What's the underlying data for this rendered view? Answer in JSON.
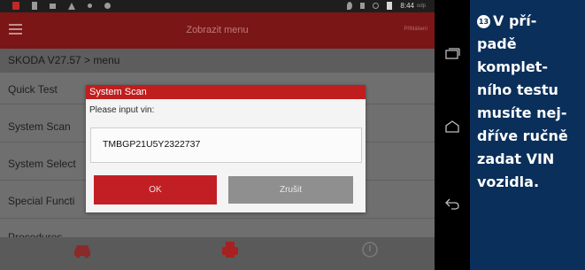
{
  "statusbar": {
    "time": "8:44",
    "ampm": "odp"
  },
  "appbar": {
    "title": "Zobrazit menu",
    "right_label": "Přihlášení"
  },
  "breadcrumb": "SKODA V27.57 > menu",
  "menu_items": [
    {
      "label": "Quick Test"
    },
    {
      "label": "System Scan"
    },
    {
      "label": "System Select"
    },
    {
      "label": "Special Functi"
    },
    {
      "label": "Procedures"
    }
  ],
  "dialog": {
    "title": "System Scan",
    "prompt": "Please input vin:",
    "vin_value": "TMBGP21U5Y2322737",
    "ok_label": "OK",
    "cancel_label": "Zrušit"
  },
  "caption": {
    "number": "13",
    "lines": [
      "V pří-",
      "padě",
      "komplet-",
      "ního testu",
      "musíte nej-",
      "dříve ručně",
      "zadat VIN",
      "vozidla."
    ]
  },
  "colors": {
    "appbar": "#7a1616",
    "dialog_title": "#bf1e1e",
    "ok_button": "#c21f24",
    "caption_bg": "#0a2f5a"
  }
}
